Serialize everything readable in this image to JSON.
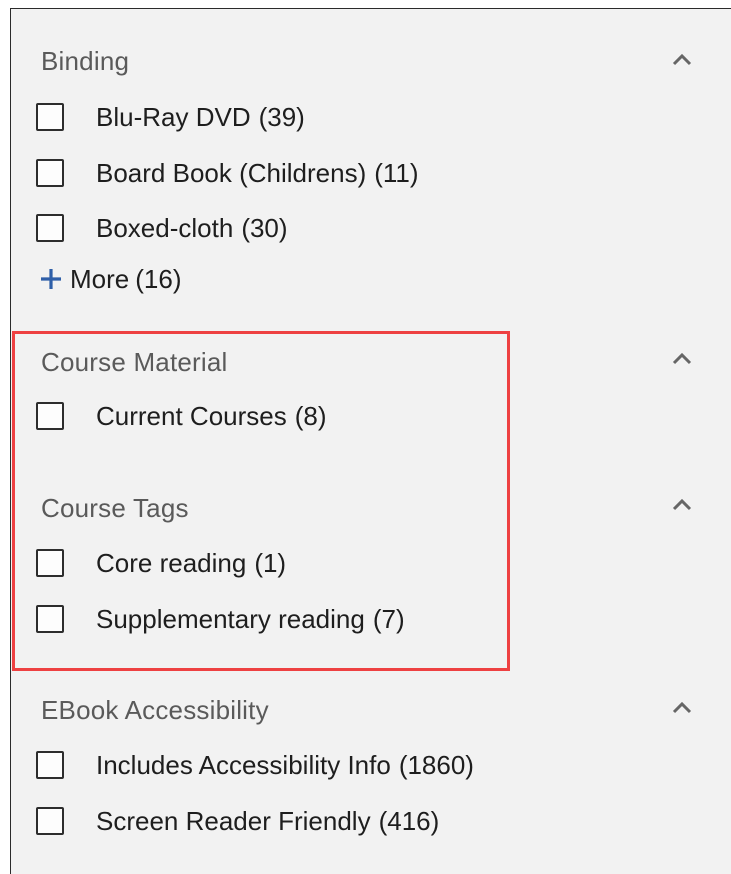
{
  "sections": [
    {
      "title": "Binding",
      "options": [
        {
          "label": "Blu-Ray DVD",
          "count": "(39)"
        },
        {
          "label": "Board Book (Childrens)",
          "count": "(11)"
        },
        {
          "label": "Boxed-cloth",
          "count": "(30)"
        }
      ],
      "more": {
        "label": "More",
        "count": "(16)"
      }
    },
    {
      "title": "Course Material",
      "options": [
        {
          "label": "Current Courses",
          "count": "(8)"
        }
      ]
    },
    {
      "title": "Course Tags",
      "options": [
        {
          "label": "Core reading",
          "count": "(1)"
        },
        {
          "label": "Supplementary reading",
          "count": "(7)"
        }
      ]
    },
    {
      "title": "EBook Accessibility",
      "options": [
        {
          "label": "Includes Accessibility Info",
          "count": "(1860)"
        },
        {
          "label": "Screen Reader Friendly",
          "count": "(416)"
        }
      ]
    }
  ],
  "colors": {
    "panel_bg": "#f2f2f2",
    "highlight_border": "#ee4142",
    "plus_icon": "#2f5fa8",
    "title_text": "#5a5a5a"
  }
}
